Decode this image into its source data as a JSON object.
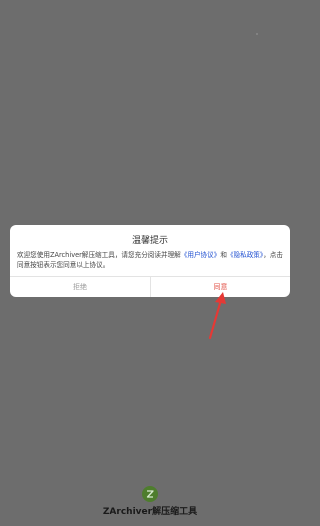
{
  "dialog": {
    "title": "温馨提示",
    "body_prefix": "欢迎您使用ZArchiver解压缩工具，请您充分阅读并理解",
    "user_agreement": "《用户协议》",
    "and_text": "和",
    "privacy_policy": "《隐私政策》",
    "body_suffix": "，点击同意按钮表示您同意以上协议。",
    "reject_label": "拒绝",
    "agree_label": "同意"
  },
  "app": {
    "name": "ZArchiver解压缩工具",
    "logo_icon": "zarchiver-logo-icon",
    "logo_color": "#4e7d2d"
  },
  "colors": {
    "overlay": "#6d6d6d",
    "link": "#1f4fd1",
    "agree": "#e2544a",
    "arrow": "#e53935"
  }
}
